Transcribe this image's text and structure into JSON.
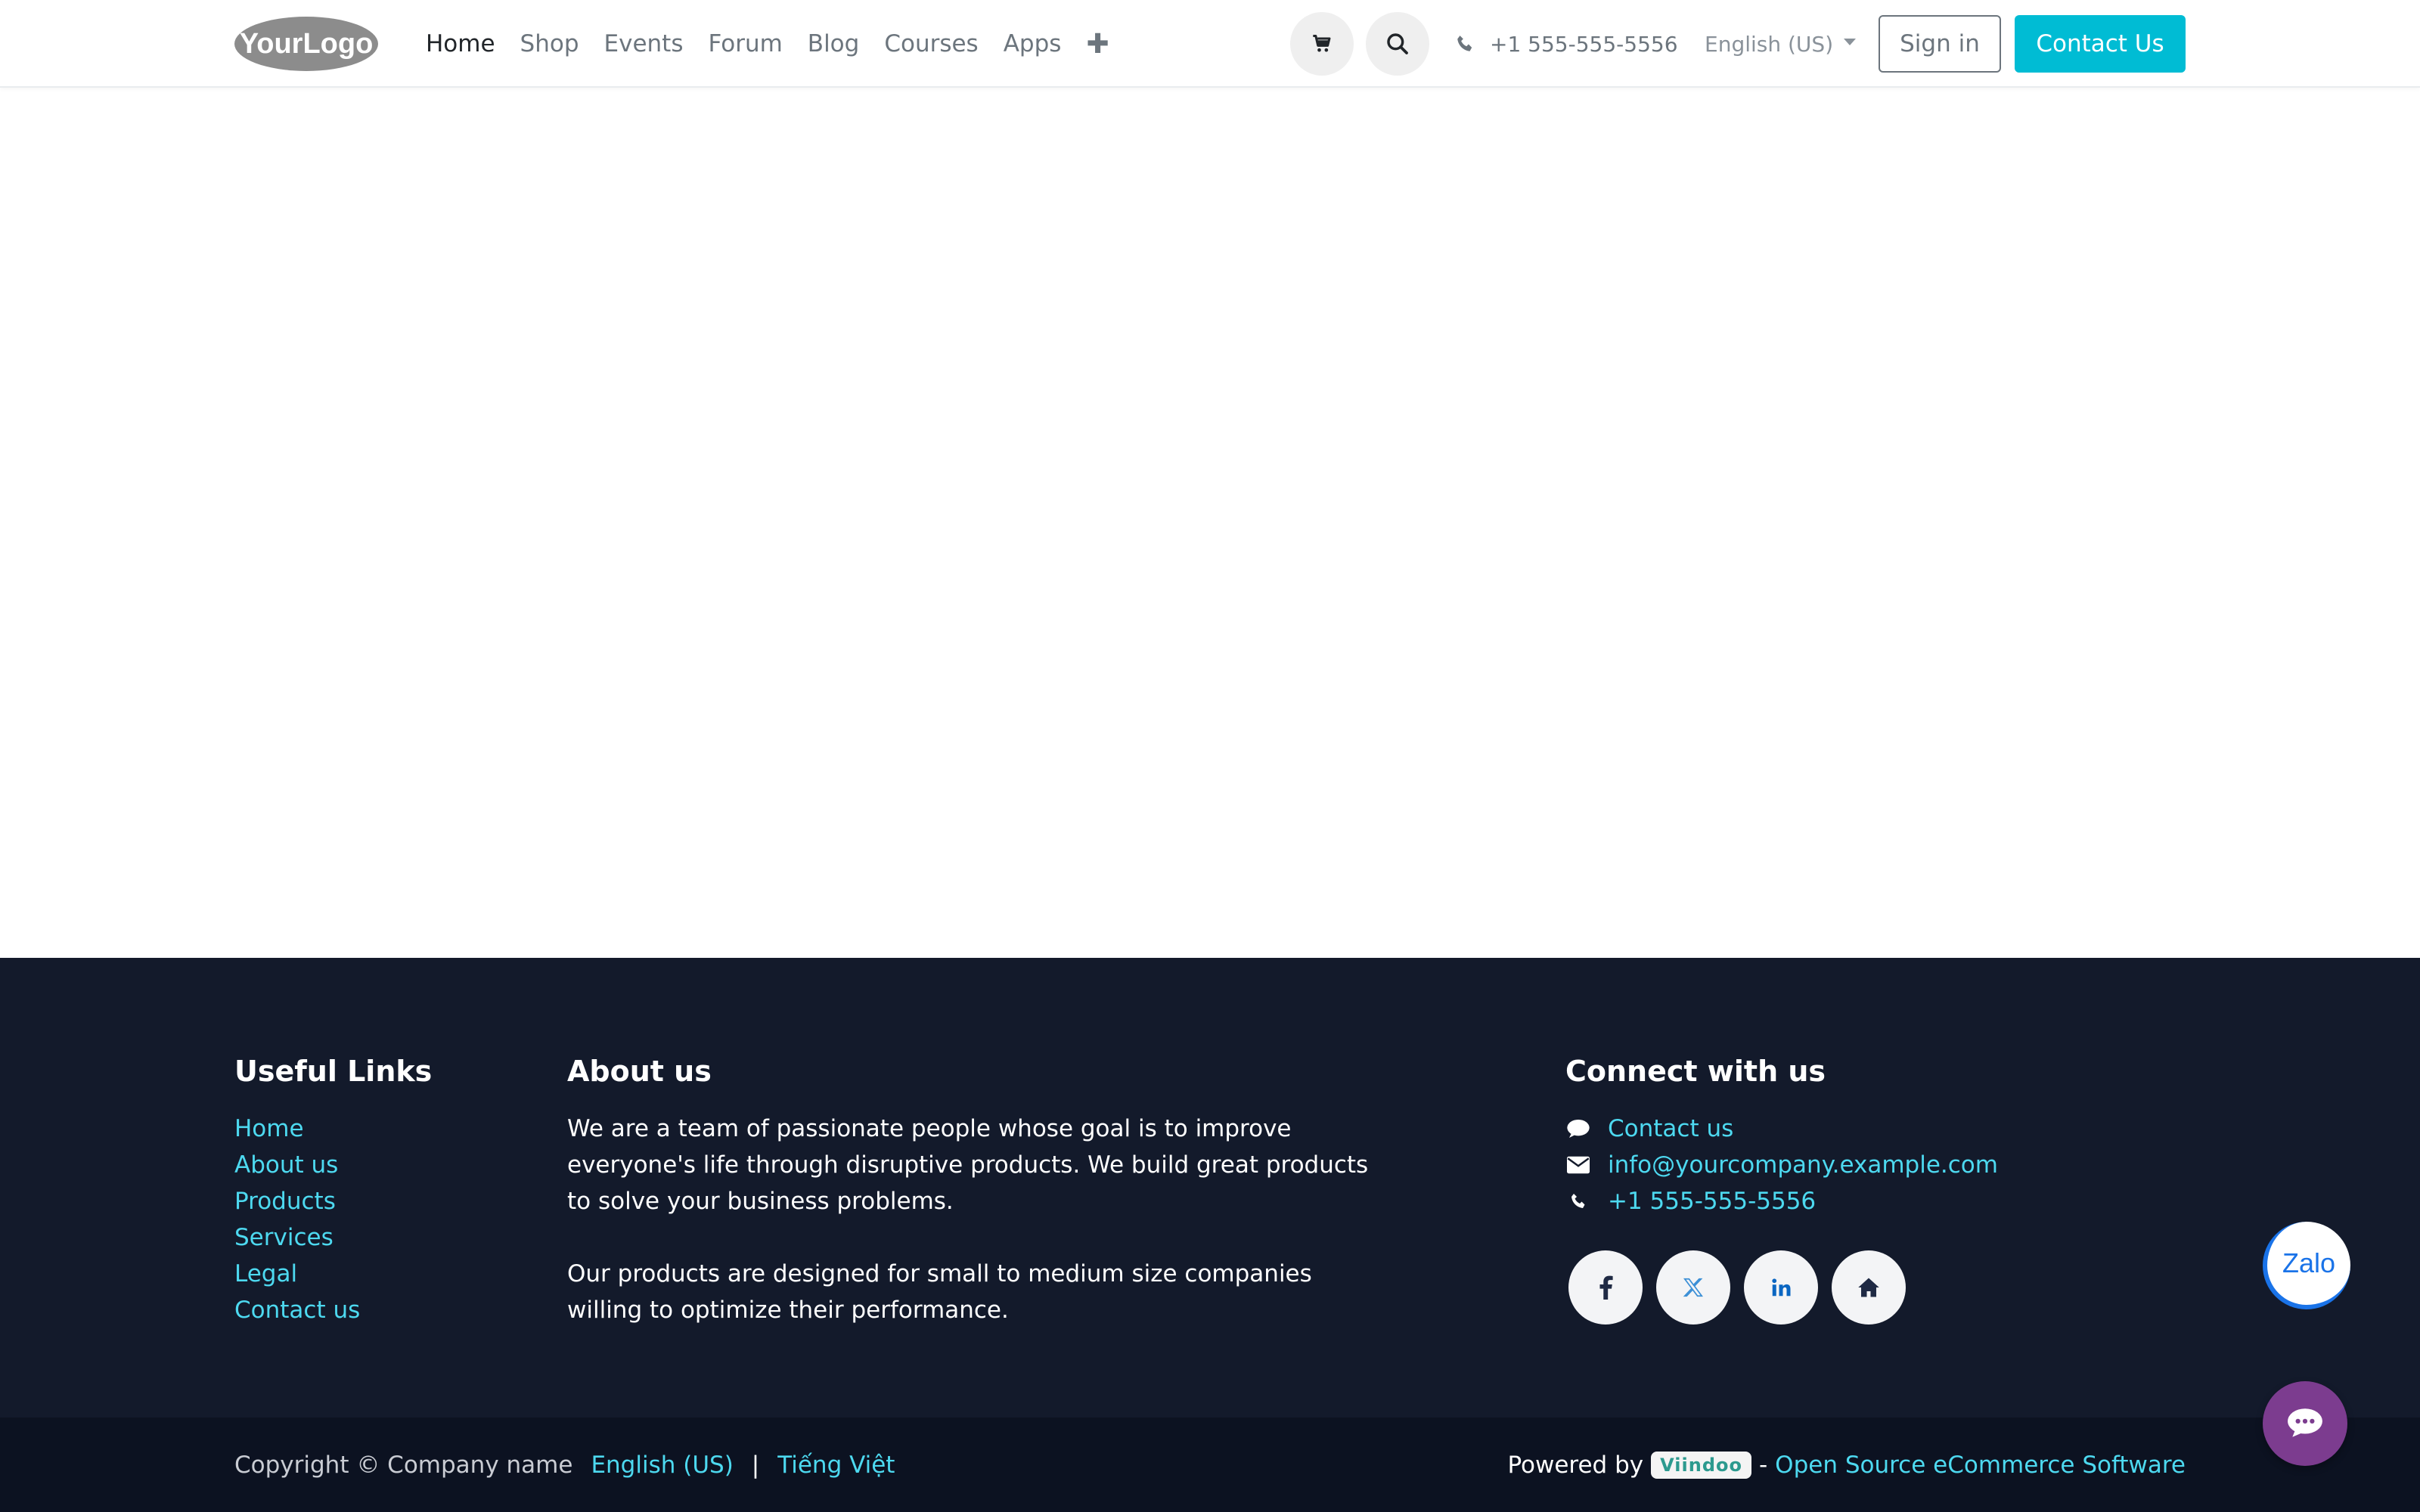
{
  "header": {
    "logo_text": "YourLogo",
    "nav": [
      "Home",
      "Shop",
      "Events",
      "Forum",
      "Blog",
      "Courses",
      "Apps"
    ],
    "plus": "✚",
    "phone": "+1 555-555-5556",
    "language": "English (US)",
    "sign_in": "Sign in",
    "contact_us": "Contact Us"
  },
  "footer": {
    "useful_links": {
      "title": "Useful Links",
      "items": [
        "Home",
        "About us",
        "Products",
        "Services",
        "Legal",
        "Contact us"
      ]
    },
    "about": {
      "title": "About us",
      "p1": "We are a team of passionate people whose goal is to improve everyone's life through disruptive products. We build great products to solve your business problems.",
      "p2": "Our products are designed for small to medium size companies willing to optimize their performance."
    },
    "connect": {
      "title": "Connect with us",
      "contact": "Contact us",
      "email": "info@yourcompany.example.com",
      "phone": "+1 555-555-5556",
      "socials": [
        "facebook-icon",
        "x-icon",
        "linkedin-icon",
        "home-icon"
      ]
    },
    "copyright": "Copyright © Company name",
    "lang_en": "English (US)",
    "separator": "|",
    "lang_vi": "Tiếng Việt",
    "powered_by": "Powered by",
    "brand": "Viindoo",
    "dash": "-",
    "open_source": "Open Source eCommerce Software"
  },
  "widgets": {
    "zalo": "Zalo"
  },
  "colors": {
    "accent": "#00bcd4",
    "link": "#4dd9f0",
    "footer_bg": "#131a2b",
    "chat_bg": "#7c3c8f"
  }
}
